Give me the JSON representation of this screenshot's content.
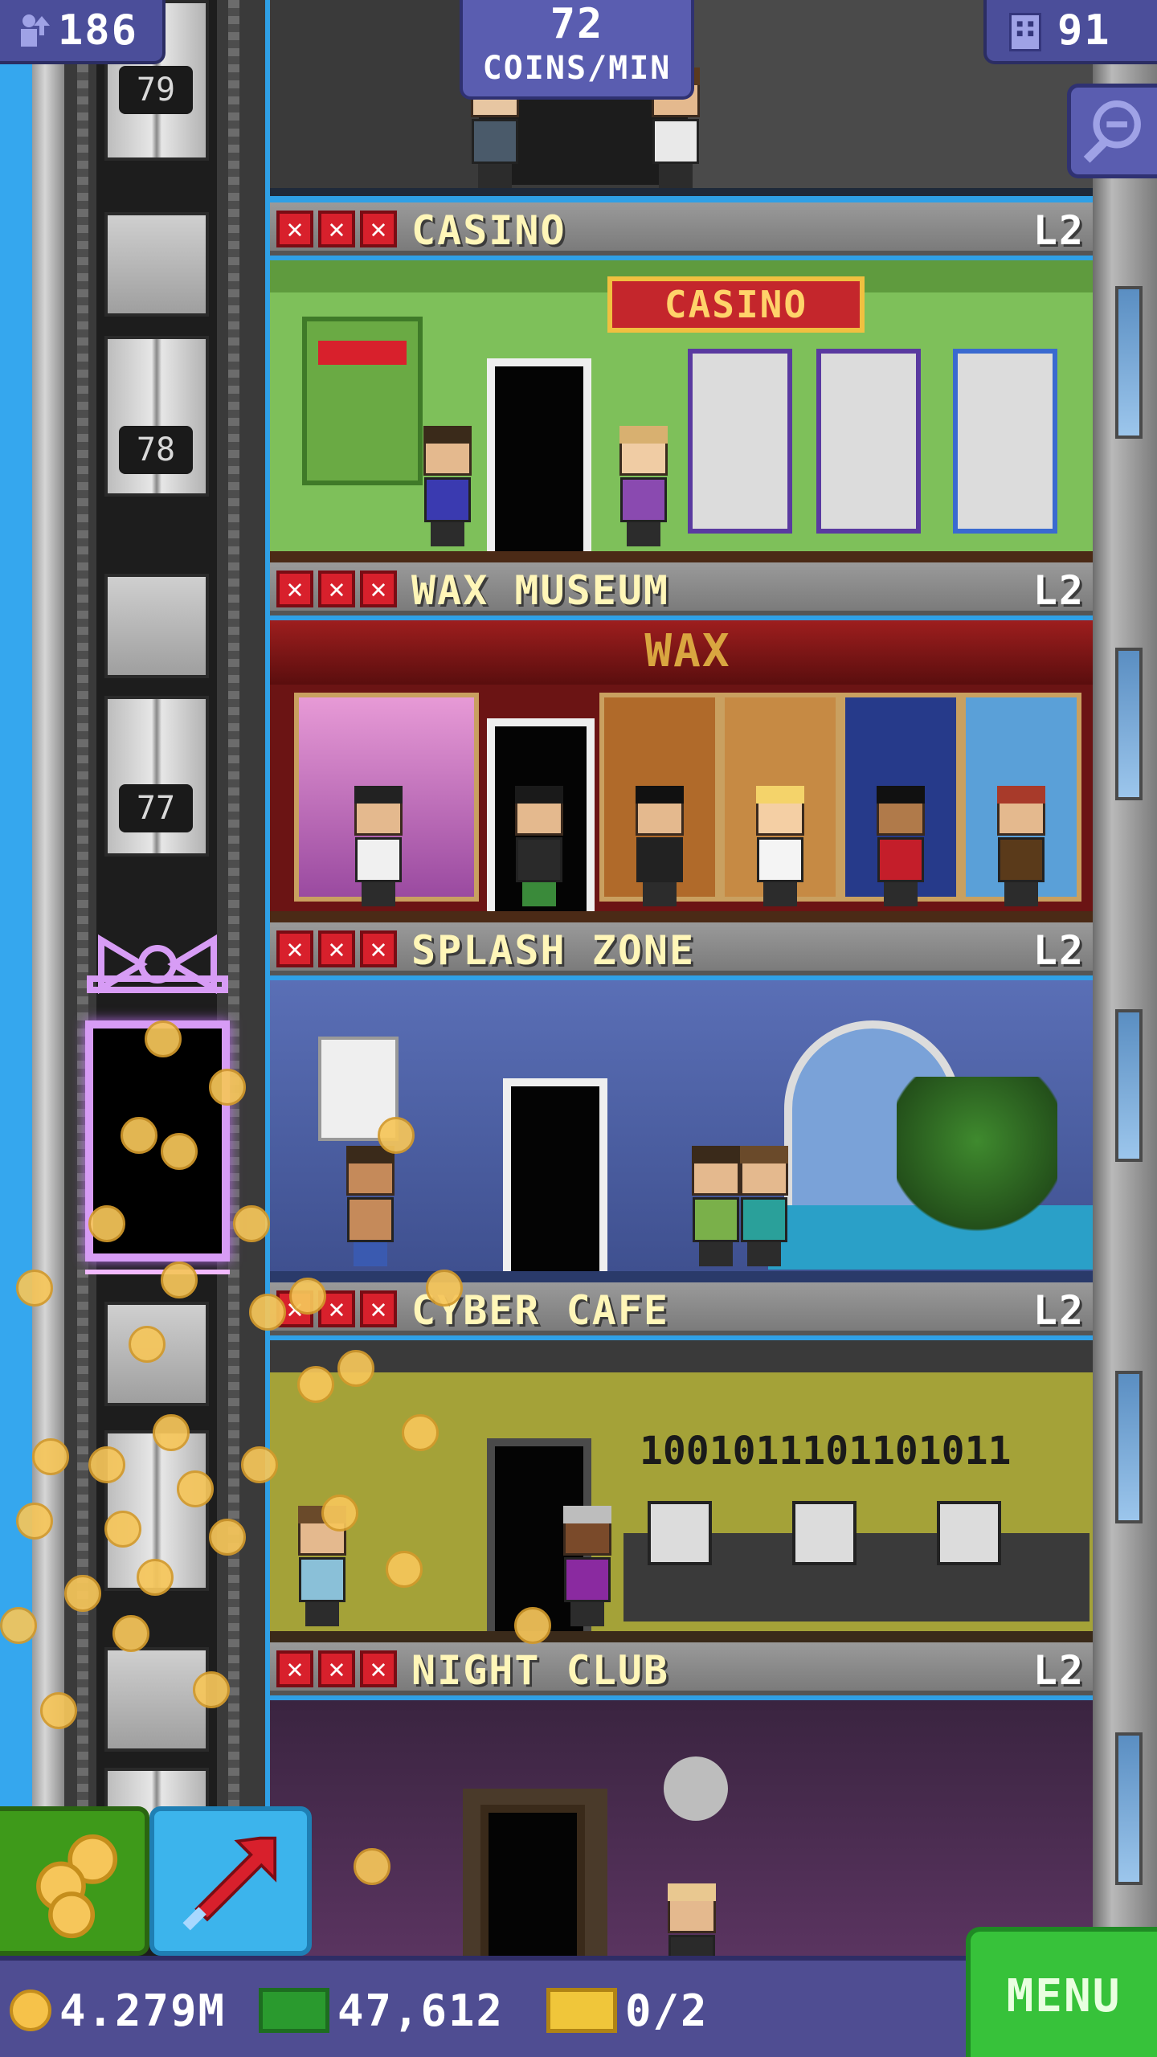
{
  "hud": {
    "population": "186",
    "coins_per_min": "72",
    "coins_per_min_label": "COINS/MIN",
    "floor_count": "91"
  },
  "elevator": {
    "floor_numbers": [
      "79",
      "78",
      "77"
    ]
  },
  "floors": [
    {
      "name": "CASINO",
      "level": "L2",
      "sign": "CASINO",
      "theme_color": "#7ec05a"
    },
    {
      "name": "WAX MUSEUM",
      "level": "L2",
      "sign": "WAX",
      "theme_color": "#6b1414"
    },
    {
      "name": "SPLASH ZONE",
      "level": "L2",
      "theme_color": "#4a5ea8"
    },
    {
      "name": "CYBER CAFE",
      "level": "L2",
      "binary_text": "1001011101101011",
      "theme_color": "#a4a238"
    },
    {
      "name": "NIGHT CLUB",
      "level": "L2",
      "theme_color": "#4a2a4c"
    }
  ],
  "bottom_bar": {
    "coins": "4.279M",
    "bux": "47,612",
    "tickets": "0/2",
    "menu_label": "MENU"
  },
  "icons": {
    "population": "person-up-icon",
    "floors": "building-icon",
    "search": "magnifier-minus-icon",
    "coins_button": "coins-icon",
    "elevator_up": "arrow-up-right-icon",
    "bux": "bux-icon",
    "ticket": "golden-ticket-icon"
  },
  "colors": {
    "hud_purple": "#4b4e9a",
    "menu_green": "#37c23a",
    "floor_name_text": "#fff6b8",
    "star_red": "#d8202c",
    "gift_neon": "#d79cf5"
  }
}
